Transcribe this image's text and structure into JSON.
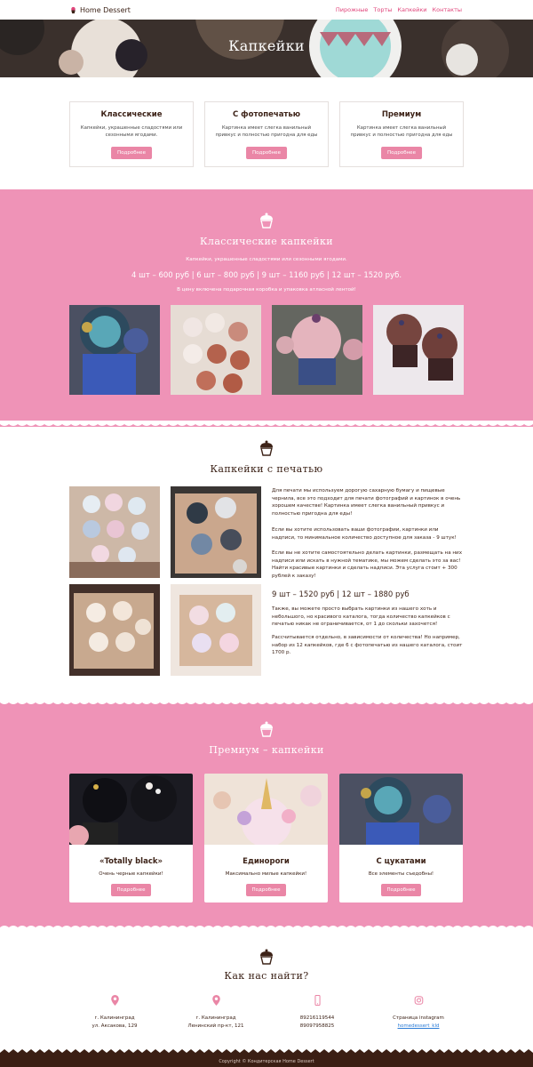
{
  "colors": {
    "accent": "#e0457b",
    "pink": "#ef93b7",
    "button": "#ea86a6",
    "dark": "#3d2318"
  },
  "navbar": {
    "brand": "Home Dessert",
    "links": [
      "Пирожные",
      "Торты",
      "Капкейки",
      "Контакты"
    ]
  },
  "hero": {
    "title": "Капкейки"
  },
  "cards": [
    {
      "title": "Классические",
      "text": "Капкейки, украшенные сладостями или сезонными ягодами.",
      "button": "Подробнее"
    },
    {
      "title": "С фотопечатью",
      "text": "Картинка имеет слегка ванильный привкус и полностью пригодна для еды",
      "button": "Подробнее"
    },
    {
      "title": "Премиум",
      "text": "Картинка имеет слегка ванильный привкус и полностью пригодна для еды",
      "button": "Подробнее"
    }
  ],
  "classic": {
    "title": "Классические капкейки",
    "subtitle": "Капкейки, украшенные сладостями или сезонными ягодами.",
    "prices": "4 шт – 600 руб | 6 шт – 800 руб | 9 шт – 1160 руб | 12 шт – 1520 руб.",
    "note": "В цену включена подарочная коробка и упаковка атласной лентой!"
  },
  "printed": {
    "title": "Капкейки с печатью",
    "p1": "Для печати мы используем дорогую сахарную бумагу и пищевые чернила, все это подходит для печати фотографий и картинок в очень хорошем качестве! Картинка имеет слегка ванильный привкус и полностью пригодна для еды!",
    "p2": "Если вы хотите использовать ваши фотографии, картинки или надписи, то минимальное количество доступное для заказа - 9 штук!",
    "p3": "Если вы не хотите самостоятельно делать картинки, размещать на них надписи или искать в нужной тематике, мы можем сделать это за вас! Найти красивые картинки и сделать надписи. Эта услуга стоит + 300 рублей к заказу!",
    "prices": "9 шт – 1520 руб | 12 шт – 1880 руб",
    "p4": "Также, вы можете просто выбрать картинки из нашего хоть и небольшого, но красивого каталога, тогда количество капкейков с печатью никак не ограничивается, от 1 до скольки захочется!",
    "p5": "Рассчитывается отдельно, в зависимости от количества! Но например, набор из 12 капкейков, где 6 с фотопечатью из нашего каталога, стоит 1700 р."
  },
  "premium": {
    "title": "Премиум – капкейки",
    "items": [
      {
        "title": "«Totally black»",
        "text": "Очень черные капкейки!",
        "button": "Подробнее"
      },
      {
        "title": "Единороги",
        "text": "Максимально милые капкейки!",
        "button": "Подробнее"
      },
      {
        "title": "С цукатами",
        "text": "Все элементы съедобны!",
        "button": "Подробнее"
      }
    ]
  },
  "contacts": {
    "title": "Как нас найти?",
    "addr1": {
      "l1": "г. Калининград",
      "l2": "ул. Аксакова, 129"
    },
    "addr2": {
      "l1": "г. Калининград",
      "l2": "Ленинский пр-кт, 121"
    },
    "phones": {
      "l1": "89216119544",
      "l2": "89097958825"
    },
    "instagram": {
      "l1": "Страница instagram",
      "l2": "homedessert_kld"
    }
  },
  "footer": {
    "text": "Copyright © Кондитерская Home Dessert"
  }
}
